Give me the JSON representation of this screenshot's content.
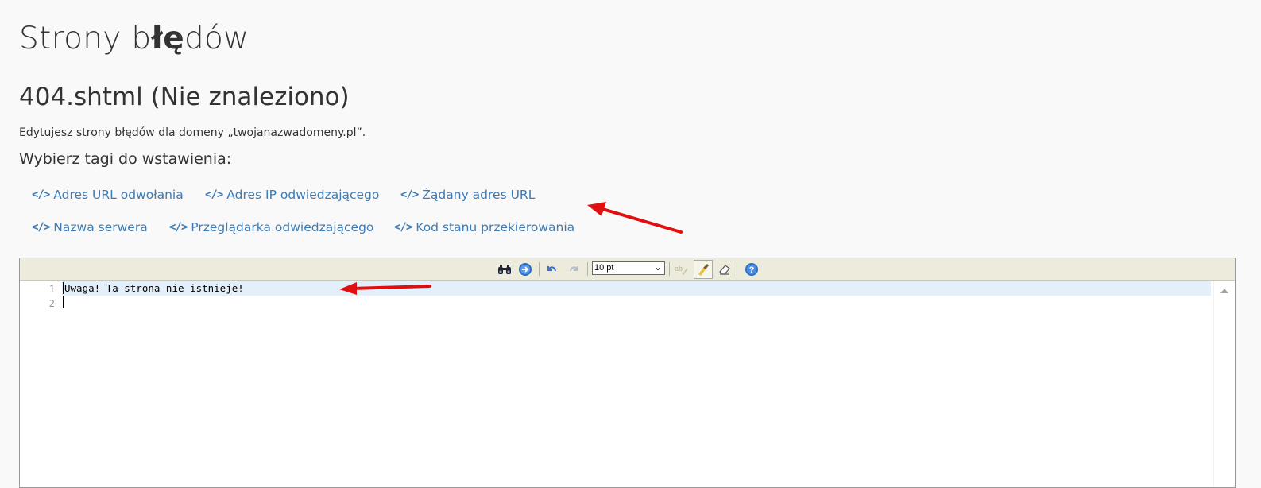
{
  "header": {
    "title_prefix": "Strony b",
    "title_bold": "łę",
    "title_suffix": "dów",
    "subtitle": "404.shtml (Nie znaleziono)",
    "description": "Edytujesz strony błędów dla domeny „twojanazwadomeny.pl”.",
    "tags_heading": "Wybierz tagi do wstawienia:"
  },
  "tags": [
    {
      "label": "Adres URL odwołania",
      "icon": "code-icon"
    },
    {
      "label": "Adres IP odwiedzającego",
      "icon": "code-icon"
    },
    {
      "label": "Żądany adres URL",
      "icon": "code-icon"
    },
    {
      "label": "Nazwa serwera",
      "icon": "code-icon"
    },
    {
      "label": "Przeglądarka odwiedzającego",
      "icon": "code-icon"
    },
    {
      "label": "Kod stanu przekierowania",
      "icon": "code-icon"
    }
  ],
  "tag_icon_glyph": "</>",
  "toolbar": {
    "font_size": "10 pt",
    "icons": [
      "search-icon",
      "go-to-line-icon",
      "undo-icon",
      "redo-icon",
      "spellcheck-icon",
      "highlight-icon",
      "reset-icon",
      "help-icon"
    ]
  },
  "editor": {
    "lines": [
      {
        "number": "1",
        "text": "Uwaga! Ta strona nie istnieje!"
      },
      {
        "number": "2",
        "text": ""
      }
    ]
  },
  "colors": {
    "link": "#3d7bb5",
    "annotation_arrow": "#e01010",
    "toolbar_bg": "#ecebdc",
    "active_line": "#e3effa"
  }
}
